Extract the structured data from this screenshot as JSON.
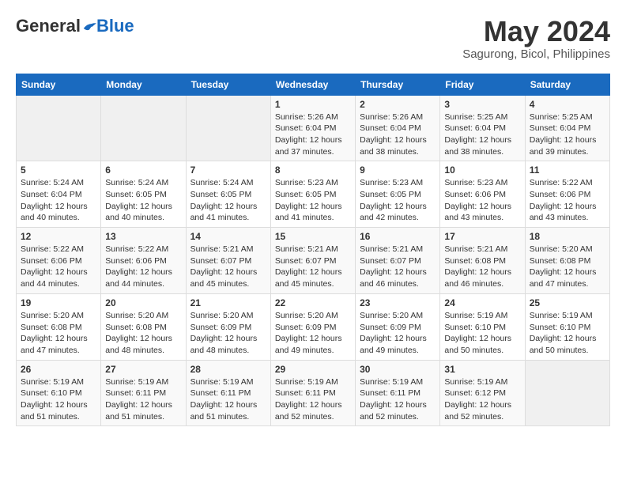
{
  "header": {
    "logo_general": "General",
    "logo_blue": "Blue",
    "month_title": "May 2024",
    "subtitle": "Sagurong, Bicol, Philippines"
  },
  "calendar": {
    "days_of_week": [
      "Sunday",
      "Monday",
      "Tuesday",
      "Wednesday",
      "Thursday",
      "Friday",
      "Saturday"
    ],
    "weeks": [
      [
        {
          "day": "",
          "info": ""
        },
        {
          "day": "",
          "info": ""
        },
        {
          "day": "",
          "info": ""
        },
        {
          "day": "1",
          "info": "Sunrise: 5:26 AM\nSunset: 6:04 PM\nDaylight: 12 hours and 37 minutes."
        },
        {
          "day": "2",
          "info": "Sunrise: 5:26 AM\nSunset: 6:04 PM\nDaylight: 12 hours and 38 minutes."
        },
        {
          "day": "3",
          "info": "Sunrise: 5:25 AM\nSunset: 6:04 PM\nDaylight: 12 hours and 38 minutes."
        },
        {
          "day": "4",
          "info": "Sunrise: 5:25 AM\nSunset: 6:04 PM\nDaylight: 12 hours and 39 minutes."
        }
      ],
      [
        {
          "day": "5",
          "info": "Sunrise: 5:24 AM\nSunset: 6:04 PM\nDaylight: 12 hours and 40 minutes."
        },
        {
          "day": "6",
          "info": "Sunrise: 5:24 AM\nSunset: 6:05 PM\nDaylight: 12 hours and 40 minutes."
        },
        {
          "day": "7",
          "info": "Sunrise: 5:24 AM\nSunset: 6:05 PM\nDaylight: 12 hours and 41 minutes."
        },
        {
          "day": "8",
          "info": "Sunrise: 5:23 AM\nSunset: 6:05 PM\nDaylight: 12 hours and 41 minutes."
        },
        {
          "day": "9",
          "info": "Sunrise: 5:23 AM\nSunset: 6:05 PM\nDaylight: 12 hours and 42 minutes."
        },
        {
          "day": "10",
          "info": "Sunrise: 5:23 AM\nSunset: 6:06 PM\nDaylight: 12 hours and 43 minutes."
        },
        {
          "day": "11",
          "info": "Sunrise: 5:22 AM\nSunset: 6:06 PM\nDaylight: 12 hours and 43 minutes."
        }
      ],
      [
        {
          "day": "12",
          "info": "Sunrise: 5:22 AM\nSunset: 6:06 PM\nDaylight: 12 hours and 44 minutes."
        },
        {
          "day": "13",
          "info": "Sunrise: 5:22 AM\nSunset: 6:06 PM\nDaylight: 12 hours and 44 minutes."
        },
        {
          "day": "14",
          "info": "Sunrise: 5:21 AM\nSunset: 6:07 PM\nDaylight: 12 hours and 45 minutes."
        },
        {
          "day": "15",
          "info": "Sunrise: 5:21 AM\nSunset: 6:07 PM\nDaylight: 12 hours and 45 minutes."
        },
        {
          "day": "16",
          "info": "Sunrise: 5:21 AM\nSunset: 6:07 PM\nDaylight: 12 hours and 46 minutes."
        },
        {
          "day": "17",
          "info": "Sunrise: 5:21 AM\nSunset: 6:08 PM\nDaylight: 12 hours and 46 minutes."
        },
        {
          "day": "18",
          "info": "Sunrise: 5:20 AM\nSunset: 6:08 PM\nDaylight: 12 hours and 47 minutes."
        }
      ],
      [
        {
          "day": "19",
          "info": "Sunrise: 5:20 AM\nSunset: 6:08 PM\nDaylight: 12 hours and 47 minutes."
        },
        {
          "day": "20",
          "info": "Sunrise: 5:20 AM\nSunset: 6:08 PM\nDaylight: 12 hours and 48 minutes."
        },
        {
          "day": "21",
          "info": "Sunrise: 5:20 AM\nSunset: 6:09 PM\nDaylight: 12 hours and 48 minutes."
        },
        {
          "day": "22",
          "info": "Sunrise: 5:20 AM\nSunset: 6:09 PM\nDaylight: 12 hours and 49 minutes."
        },
        {
          "day": "23",
          "info": "Sunrise: 5:20 AM\nSunset: 6:09 PM\nDaylight: 12 hours and 49 minutes."
        },
        {
          "day": "24",
          "info": "Sunrise: 5:19 AM\nSunset: 6:10 PM\nDaylight: 12 hours and 50 minutes."
        },
        {
          "day": "25",
          "info": "Sunrise: 5:19 AM\nSunset: 6:10 PM\nDaylight: 12 hours and 50 minutes."
        }
      ],
      [
        {
          "day": "26",
          "info": "Sunrise: 5:19 AM\nSunset: 6:10 PM\nDaylight: 12 hours and 51 minutes."
        },
        {
          "day": "27",
          "info": "Sunrise: 5:19 AM\nSunset: 6:11 PM\nDaylight: 12 hours and 51 minutes."
        },
        {
          "day": "28",
          "info": "Sunrise: 5:19 AM\nSunset: 6:11 PM\nDaylight: 12 hours and 51 minutes."
        },
        {
          "day": "29",
          "info": "Sunrise: 5:19 AM\nSunset: 6:11 PM\nDaylight: 12 hours and 52 minutes."
        },
        {
          "day": "30",
          "info": "Sunrise: 5:19 AM\nSunset: 6:11 PM\nDaylight: 12 hours and 52 minutes."
        },
        {
          "day": "31",
          "info": "Sunrise: 5:19 AM\nSunset: 6:12 PM\nDaylight: 12 hours and 52 minutes."
        },
        {
          "day": "",
          "info": ""
        }
      ]
    ]
  }
}
